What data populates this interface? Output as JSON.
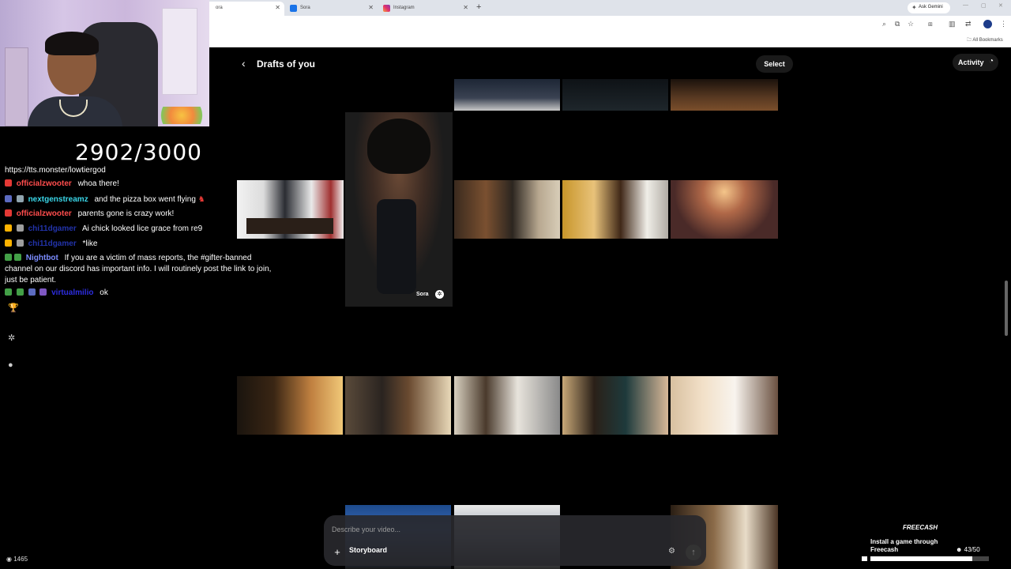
{
  "browser": {
    "tabs": [
      {
        "label": "ora",
        "color": "#000000"
      },
      {
        "label": "Sora",
        "color": "#1a73e8"
      },
      {
        "label": "Instagram",
        "color": "#e1306c"
      }
    ],
    "new_tab": "+",
    "gemini_label": "Ask Gemini",
    "bookmarks_label": "All Bookmarks"
  },
  "stream": {
    "counter": "2902/3000",
    "viewers": "1465"
  },
  "chat": [
    {
      "user": "",
      "user_color": "#ffffff",
      "text": "https://tts.monster/lowtiergod",
      "badges": []
    },
    {
      "user": "officialzwooter",
      "user_color": "#ff4d4d",
      "text": "whoa there!",
      "badges": [
        "#e53935"
      ]
    },
    {
      "user": "nextgenstreamz",
      "user_color": "#3ad6e8",
      "text": "and the pizza box went flying",
      "badges": [
        "#5c6bc0",
        "#90a4ae"
      ]
    },
    {
      "user": "officialzwooter",
      "user_color": "#ff4d4d",
      "text": "parents gone is crazy work!",
      "badges": [
        "#e53935"
      ]
    },
    {
      "user": "chi11dgamer",
      "user_color": "#2233aa",
      "text": "Ai chick looked lice grace from re9",
      "badges": [
        "#ffb300",
        "#9e9e9e"
      ]
    },
    {
      "user": "chi11dgamer",
      "user_color": "#2233aa",
      "text": "*like",
      "badges": [
        "#ffb300",
        "#9e9e9e"
      ]
    },
    {
      "user": "Nightbot",
      "user_color": "#7b8cff",
      "text": "If you are a victim of mass reports, the #gifter-banned channel on our discord has important info. I will routinely post the link to join, just be patient.",
      "badges": [
        "#43a047",
        "#43a047"
      ]
    },
    {
      "user": "virtualmilio",
      "user_color": "#2d2de0",
      "text": "ok",
      "badges": [
        "#43a047",
        "#43a047",
        "#5c6bc0",
        "#7e57c2"
      ]
    }
  ],
  "sora": {
    "title": "Drafts of you",
    "select_label": "Select",
    "activity_label": "Activity",
    "tall_watermark": "Sora",
    "prompt_placeholder": "Describe your video...",
    "storyboard_label": "Storyboard"
  },
  "freecash": {
    "logo": "FREECASH",
    "text": "Install a game through Freecash",
    "count": "43/50",
    "progress": 0.86
  }
}
